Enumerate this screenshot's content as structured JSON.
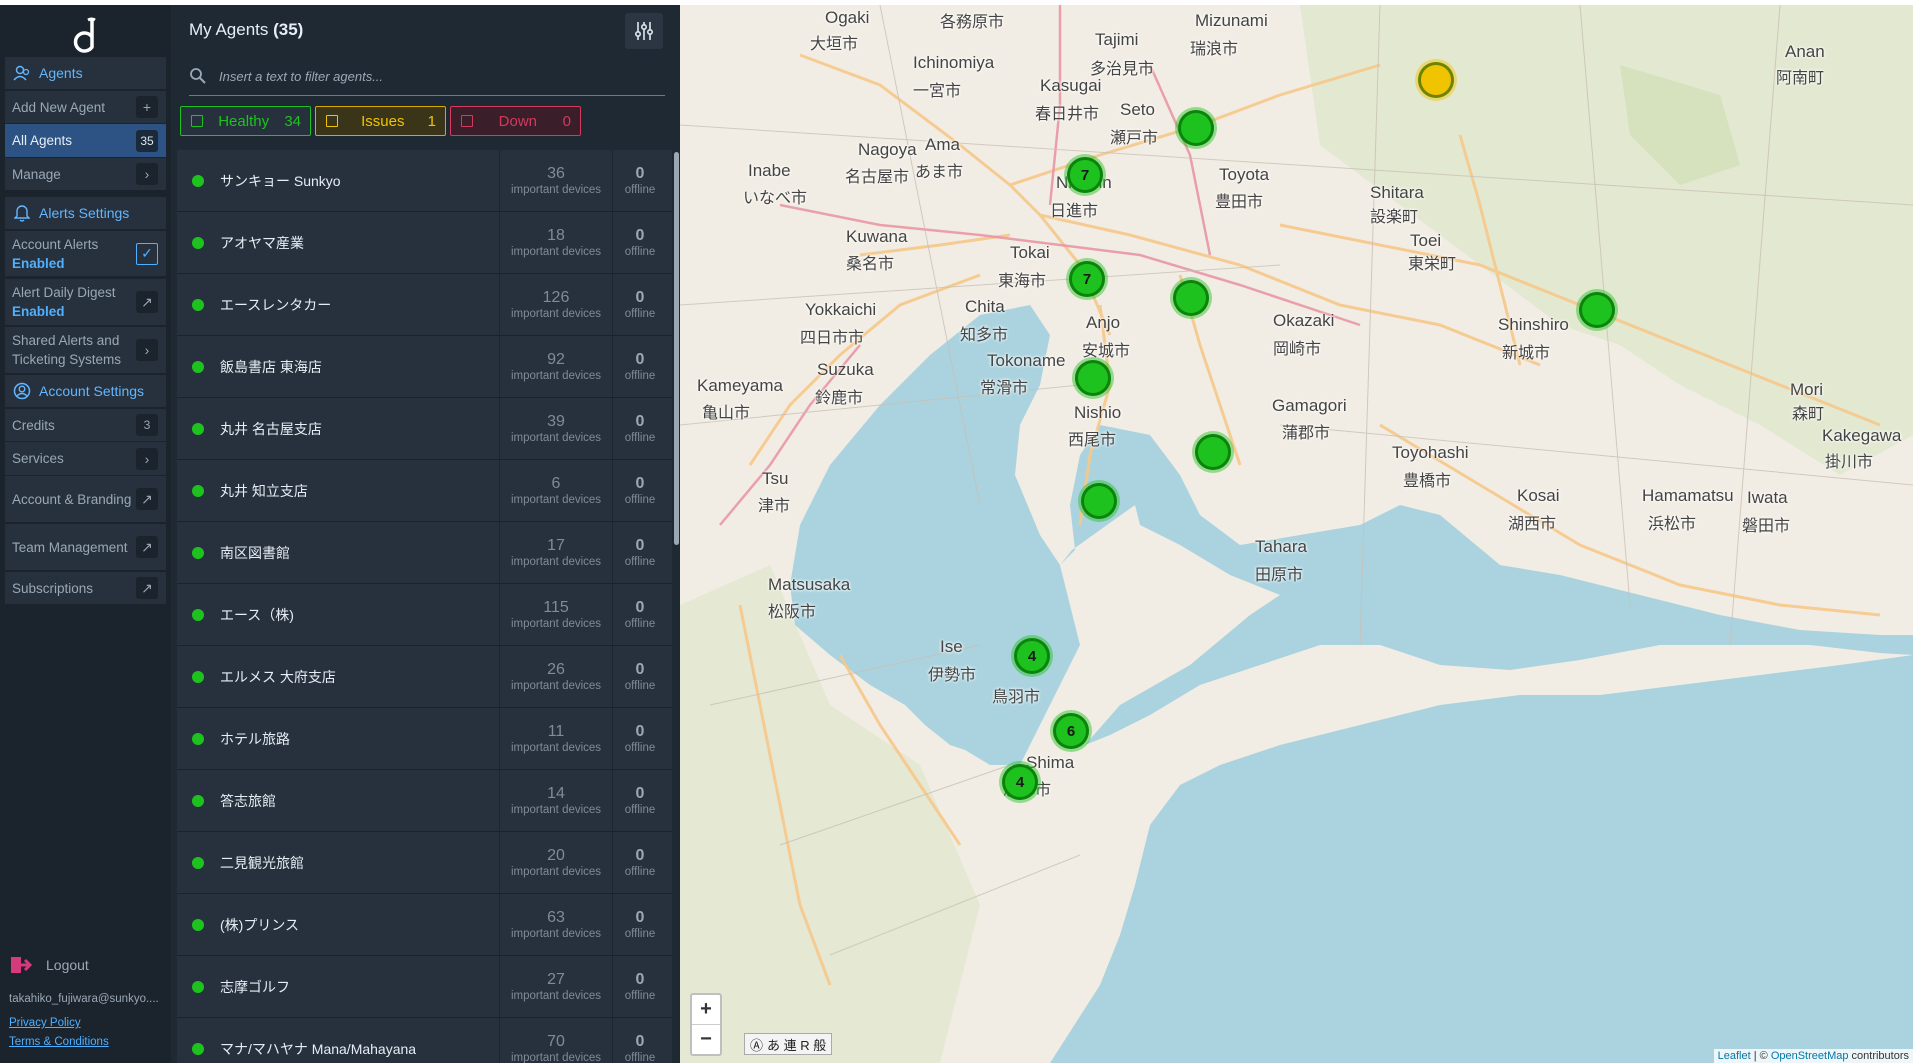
{
  "nav": {
    "agents_section": "Agents",
    "add_new_agent": "Add New Agent",
    "all_agents": "All Agents",
    "all_agents_count": "35",
    "manage": "Manage",
    "alerts_section": "Alerts Settings",
    "account_alerts": "Account Alerts",
    "account_alerts_status": "Enabled",
    "daily_digest": "Alert Daily Digest",
    "daily_digest_status": "Enabled",
    "shared_alerts": "Shared Alerts and Ticketing Systems",
    "account_section": "Account Settings",
    "credits": "Credits",
    "credits_count": "3",
    "services": "Services",
    "account_branding": "Account & Branding",
    "team_management": "Team Management",
    "subscriptions": "Subscriptions",
    "logout": "Logout",
    "email": "takahiko_fujiwara@sunkyo....",
    "privacy": "Privacy Policy",
    "terms": "Terms & Conditions"
  },
  "panel": {
    "title": "My Agents",
    "count": "(35)",
    "search_placeholder": "Insert a text to filter agents...",
    "healthy_label": "Healthy",
    "healthy_count": "34",
    "issues_label": "Issues",
    "issues_count": "1",
    "down_label": "Down",
    "down_count": "0",
    "devices_label": "important devices",
    "offline_label": "offline"
  },
  "agents": [
    {
      "name": "サンキョー Sunkyo",
      "devices": "36",
      "offline": "0"
    },
    {
      "name": "アオヤマ産業",
      "devices": "18",
      "offline": "0"
    },
    {
      "name": "エースレンタカー",
      "devices": "126",
      "offline": "0"
    },
    {
      "name": "飯島書店 東海店",
      "devices": "92",
      "offline": "0"
    },
    {
      "name": "丸井 名古屋支店",
      "devices": "39",
      "offline": "0"
    },
    {
      "name": "丸井 知立支店",
      "devices": "6",
      "offline": "0"
    },
    {
      "name": "南区図書館",
      "devices": "17",
      "offline": "0"
    },
    {
      "name": "エース（株)",
      "devices": "115",
      "offline": "0"
    },
    {
      "name": "エルメス 大府支店",
      "devices": "26",
      "offline": "0"
    },
    {
      "name": "ホテル旅路",
      "devices": "11",
      "offline": "0"
    },
    {
      "name": "答志旅館",
      "devices": "14",
      "offline": "0"
    },
    {
      "name": "二見観光旅館",
      "devices": "20",
      "offline": "0"
    },
    {
      "name": "(株)プリンス",
      "devices": "63",
      "offline": "0"
    },
    {
      "name": "志摩ゴルフ",
      "devices": "27",
      "offline": "0"
    },
    {
      "name": "マナ/マハヤナ Mana/Mahayana",
      "devices": "70",
      "offline": "0"
    }
  ],
  "map": {
    "labels": [
      {
        "text": "Ogaki"
      },
      {
        "text": "大垣市"
      },
      {
        "text": "各務原市"
      },
      {
        "text": "Mizunami"
      },
      {
        "text": "瑞浪市"
      },
      {
        "text": "Tajimi"
      },
      {
        "text": "多治見市"
      },
      {
        "text": "Ichinomiya"
      },
      {
        "text": "一宮市"
      },
      {
        "text": "Kasugai"
      },
      {
        "text": "春日井市"
      },
      {
        "text": "Seto"
      },
      {
        "text": "瀬戸市"
      },
      {
        "text": "Nagoya"
      },
      {
        "text": "名古屋市"
      },
      {
        "text": "Ama"
      },
      {
        "text": "あま市"
      },
      {
        "text": "Inabe"
      },
      {
        "text": "いなべ市"
      },
      {
        "text": "Nisshin"
      },
      {
        "text": "日進市"
      },
      {
        "text": "Toyota"
      },
      {
        "text": "豊田市"
      },
      {
        "text": "Shitara"
      },
      {
        "text": "設楽町"
      },
      {
        "text": "Kuwana"
      },
      {
        "text": "桑名市"
      },
      {
        "text": "Tokai"
      },
      {
        "text": "東海市"
      },
      {
        "text": "Toei"
      },
      {
        "text": "東栄町"
      },
      {
        "text": "Yokkaichi"
      },
      {
        "text": "四日市市"
      },
      {
        "text": "Chita"
      },
      {
        "text": "知多市"
      },
      {
        "text": "Anjo"
      },
      {
        "text": "安城市"
      },
      {
        "text": "Okazaki"
      },
      {
        "text": "岡崎市"
      },
      {
        "text": "Shinshiro"
      },
      {
        "text": "新城市"
      },
      {
        "text": "Suzuka"
      },
      {
        "text": "鈴鹿市"
      },
      {
        "text": "Tokoname"
      },
      {
        "text": "常滑市"
      },
      {
        "text": "Kameyama"
      },
      {
        "text": "亀山市"
      },
      {
        "text": "Nishio"
      },
      {
        "text": "西尾市"
      },
      {
        "text": "Gamagori"
      },
      {
        "text": "蒲郡市"
      },
      {
        "text": "Toyohashi"
      },
      {
        "text": "豊橋市"
      },
      {
        "text": "Tsu"
      },
      {
        "text": "津市"
      },
      {
        "text": "Kosai"
      },
      {
        "text": "湖西市"
      },
      {
        "text": "Hamamatsu"
      },
      {
        "text": "浜松市"
      },
      {
        "text": "Iwata"
      },
      {
        "text": "磐田市"
      },
      {
        "text": "Kakegawa"
      },
      {
        "text": "掛川市"
      },
      {
        "text": "Tahara"
      },
      {
        "text": "田原市"
      },
      {
        "text": "Matsusaka"
      },
      {
        "text": "松阪市"
      },
      {
        "text": "Ise"
      },
      {
        "text": "伊勢市"
      },
      {
        "text": "鳥羽市"
      },
      {
        "text": "Shima"
      },
      {
        "text": "志摩市"
      },
      {
        "text": "Mori"
      },
      {
        "text": "森町"
      },
      {
        "text": "Anan"
      },
      {
        "text": "阿南町"
      }
    ],
    "markers": [
      {
        "label": "",
        "status": "issue"
      },
      {
        "label": "",
        "status": "healthy"
      },
      {
        "label": "7",
        "status": "healthy"
      },
      {
        "label": "7",
        "status": "healthy"
      },
      {
        "label": "",
        "status": "healthy"
      },
      {
        "label": "",
        "status": "healthy"
      },
      {
        "label": "",
        "status": "healthy"
      },
      {
        "label": "",
        "status": "healthy"
      },
      {
        "label": "",
        "status": "healthy"
      },
      {
        "label": "4",
        "status": "healthy"
      },
      {
        "label": "6",
        "status": "healthy"
      },
      {
        "label": "4",
        "status": "healthy"
      }
    ],
    "zoom_in": "+",
    "zoom_out": "−",
    "ime": "あ 連 R 般",
    "attribution_leaflet": "Leaflet",
    "attribution_osm": "OpenStreetMap",
    "attribution_text": " | © ",
    "attribution_tail": " contributors"
  },
  "colors": {
    "healthy": "#1ec21e",
    "issue": "#f0c400",
    "down": "#d43a5c",
    "accent": "#4fb0ff"
  }
}
